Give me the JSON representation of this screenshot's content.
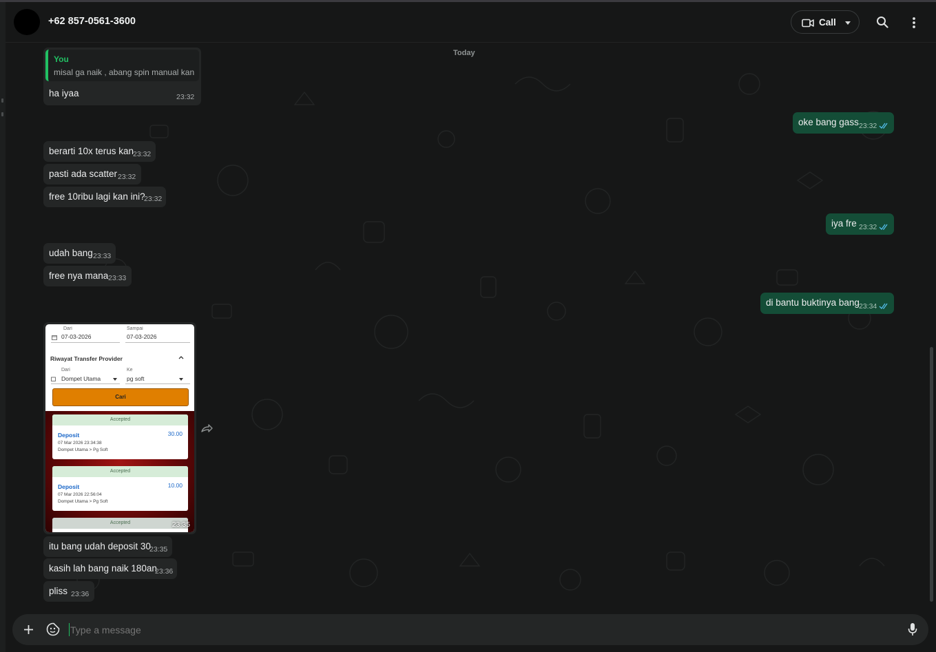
{
  "header": {
    "contact_name": "+62 857-0561-3600",
    "call_label": "Call",
    "icons": [
      "video-camera-icon",
      "chevron-down-icon",
      "search-icon",
      "menu-dots-icon"
    ]
  },
  "chat": {
    "date_divider": "Today",
    "reply_bubble": {
      "quoted_author": "You",
      "quoted_text": "misal ga naik , abang spin manual kan",
      "text": "ha iyaa",
      "time": "23:32"
    },
    "messages": [
      {
        "direction": "out",
        "text": "oke bang gass",
        "time": "23:32",
        "status": "read"
      },
      {
        "direction": "in",
        "text": "berarti 10x terus kan",
        "time": "23:32"
      },
      {
        "direction": "in",
        "text": "pasti ada scatter",
        "time": "23:32"
      },
      {
        "direction": "in",
        "text": "free 10ribu lagi kan ini?",
        "time": "23:32"
      },
      {
        "direction": "out",
        "text": "iya fre",
        "time": "23:32",
        "status": "read"
      },
      {
        "direction": "in",
        "text": "udah bang",
        "time": "23:33"
      },
      {
        "direction": "in",
        "text": "free nya mana",
        "time": "23:33"
      },
      {
        "direction": "out",
        "text": "di bantu buktinya bang",
        "time": "23:34",
        "status": "read"
      },
      {
        "direction": "in",
        "text": "itu bang udah deposit 30",
        "time": "23:35"
      },
      {
        "direction": "in",
        "text": "kasih lah bang naik 180an",
        "time": "23:36"
      },
      {
        "direction": "in",
        "text": "pliss",
        "time": "23:36"
      }
    ],
    "image_message": {
      "time": "23:35",
      "screenshot": {
        "from_label": "Dari",
        "from_date": "07-03-2026",
        "to_label": "Sampai",
        "to_date": "07-03-2026",
        "section_title": "Riwayat Transfer Provider",
        "source_label": "Dari",
        "source_value": "Dompet Utama",
        "target_label": "Ke",
        "target_value": "pg soft",
        "search_button": "Cari",
        "transactions": [
          {
            "status": "Accepted",
            "type": "Deposit",
            "amount": "30.00",
            "datetime": "07 Mar 2026 23:34:38",
            "route": "Dompet Utama  >  Pg Soft"
          },
          {
            "status": "Accepted",
            "type": "Deposit",
            "amount": "10.00",
            "datetime": "07 Mar 2026 22:56:04",
            "route": "Dompet Utama  >  Pg Soft"
          },
          {
            "status": "Accepted"
          }
        ]
      }
    }
  },
  "composer": {
    "placeholder": "Type a message",
    "icons": [
      "plus-icon",
      "sticker-icon",
      "microphone-icon"
    ]
  },
  "colors": {
    "background": "#161717",
    "incoming_bubble": "#242626",
    "outgoing_bubble": "#144d37",
    "accent_green": "#21c063",
    "read_ticks": "#53bdeb"
  }
}
